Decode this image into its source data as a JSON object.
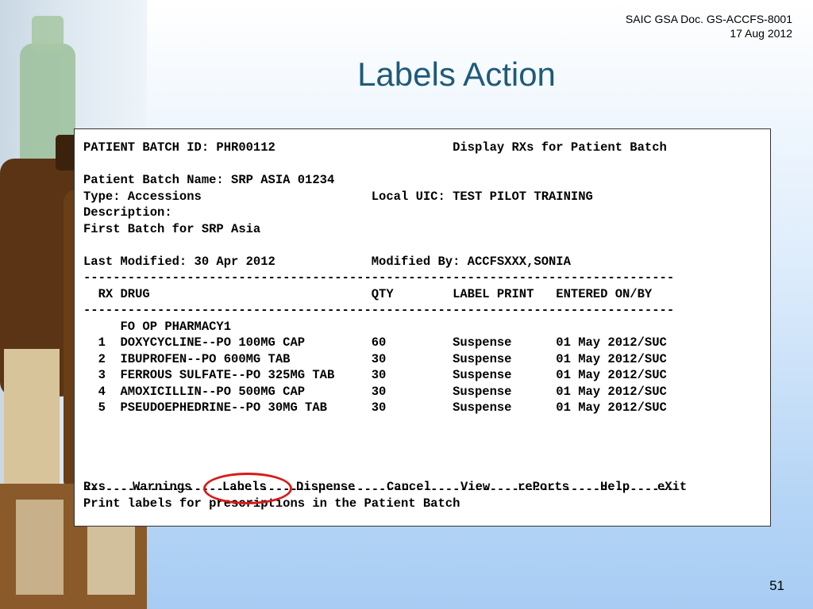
{
  "doc_ref": {
    "line1": "SAIC GSA Doc. GS-ACCFS-8001",
    "line2": "17 Aug 2012"
  },
  "title": "Labels Action",
  "terminal": {
    "lines": [
      "PATIENT BATCH ID: PHR00112                        Display RXs for Patient Batch",
      "",
      "Patient Batch Name: SRP ASIA 01234",
      "Type: Accessions                       Local UIC: TEST PILOT TRAINING",
      "Description:",
      "First Batch for SRP Asia",
      "",
      "Last Modified: 30 Apr 2012             Modified By: ACCFSXXX,SONIA",
      "--------------------------------------------------------------------------------",
      "  RX DRUG                              QTY        LABEL PRINT   ENTERED ON/BY",
      "--------------------------------------------------------------------------------",
      "     FO OP PHARMACY1",
      "  1  DOXYCYCLINE--PO 100MG CAP         60         Suspense      01 May 2012/SUC",
      "  2  IBUPROFEN--PO 600MG TAB           30         Suspense      01 May 2012/SUC",
      "  3  FERROUS SULFATE--PO 325MG TAB     30         Suspense      01 May 2012/SUC",
      "  4  AMOXICILLIN--PO 500MG CAP         30         Suspense      01 May 2012/SUC",
      "  5  PSEUDOEPHEDRINE--PO 30MG TAB      30         Suspense      01 May 2012/SUC",
      "",
      "",
      "",
      "",
      "--------------------------------------------------------------------------------"
    ],
    "commands": [
      "Rxs",
      "Warnings",
      "Labels",
      "Dispense",
      "Cancel",
      "View",
      "rePorts",
      "Help",
      "eXit"
    ],
    "status": "Print labels for prescriptions in the Patient Batch"
  },
  "slide_number": "51",
  "colors": {
    "title": "#1f5a7a",
    "highlight": "#d91a1a"
  }
}
